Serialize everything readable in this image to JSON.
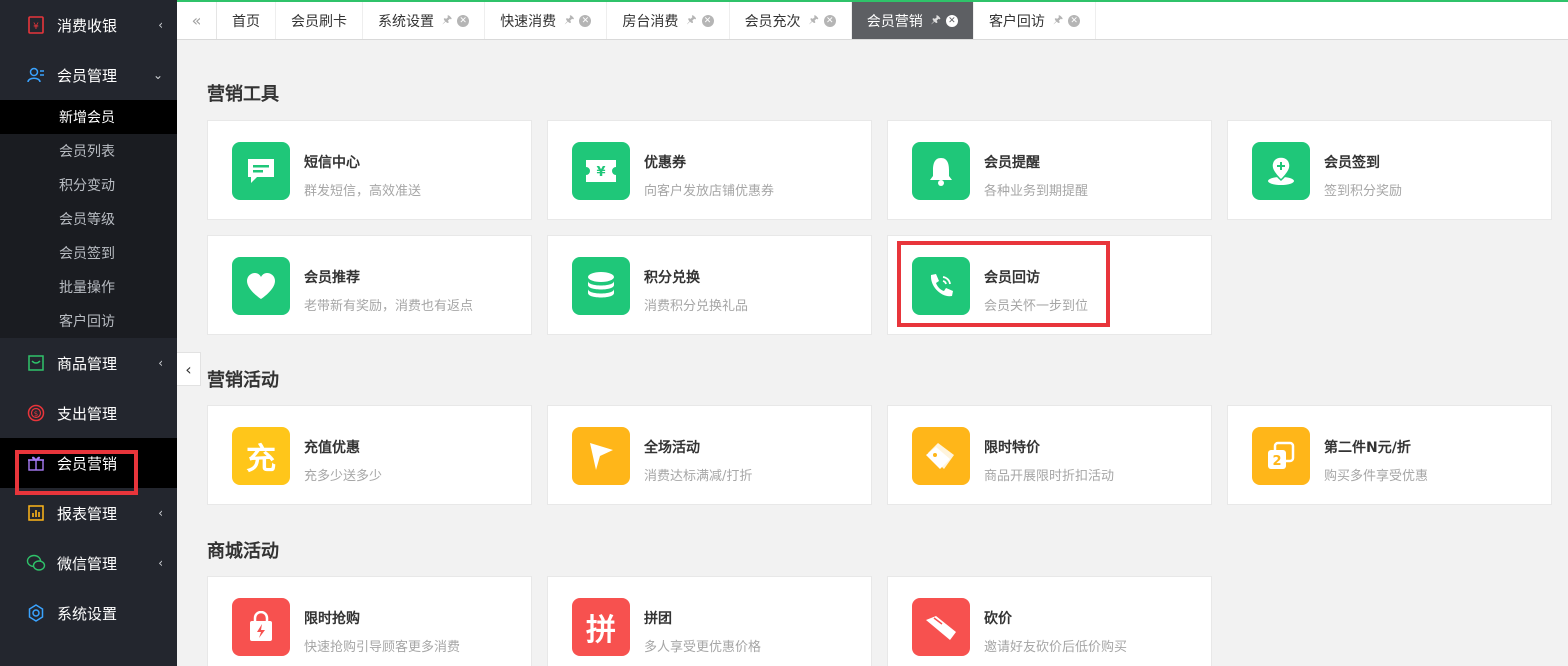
{
  "sidebar": {
    "items": [
      {
        "label": "消费收银",
        "icon": "cashier-icon",
        "arrow": "‹"
      },
      {
        "label": "会员管理",
        "icon": "member-icon",
        "arrow": "⌄"
      },
      {
        "label": "商品管理",
        "icon": "goods-icon",
        "arrow": "‹"
      },
      {
        "label": "支出管理",
        "icon": "expense-icon",
        "arrow": ""
      },
      {
        "label": "会员营销",
        "icon": "gift-icon",
        "arrow": ""
      },
      {
        "label": "报表管理",
        "icon": "report-icon",
        "arrow": "‹"
      },
      {
        "label": "微信管理",
        "icon": "wechat-icon",
        "arrow": "‹"
      },
      {
        "label": "系统设置",
        "icon": "settings-gear-icon",
        "arrow": ""
      }
    ],
    "submenu": [
      "新增会员",
      "会员列表",
      "积分变动",
      "会员等级",
      "会员签到",
      "批量操作",
      "客户回访"
    ]
  },
  "tabs": [
    {
      "label": "首页"
    },
    {
      "label": "会员刷卡"
    },
    {
      "label": "系统设置"
    },
    {
      "label": "快速消费"
    },
    {
      "label": "房台消费"
    },
    {
      "label": "会员充次"
    },
    {
      "label": "会员营销"
    },
    {
      "label": "客户回访"
    }
  ],
  "sections": {
    "tools": "营销工具",
    "activities": "营销活动",
    "mall": "商城活动"
  },
  "cards": {
    "sms": {
      "title": "短信中心",
      "desc": "群发短信，高效准送"
    },
    "coupon": {
      "title": "优惠券",
      "desc": "向客户发放店铺优惠券"
    },
    "remind": {
      "title": "会员提醒",
      "desc": "各种业务到期提醒"
    },
    "checkin": {
      "title": "会员签到",
      "desc": "签到积分奖励"
    },
    "recommend": {
      "title": "会员推荐",
      "desc": "老带新有奖励，消费也有返点"
    },
    "points": {
      "title": "积分兑换",
      "desc": "消费积分兑换礼品"
    },
    "revisit": {
      "title": "会员回访",
      "desc": "会员关怀一步到位"
    },
    "recharge": {
      "title": "充值优惠",
      "desc": "充多少送多少"
    },
    "storewide": {
      "title": "全场活动",
      "desc": "消费达标满减/打折"
    },
    "flash": {
      "title": "限时特价",
      "desc": "商品开展限时折扣活动"
    },
    "second": {
      "title": "第二件N元/折",
      "desc": "购买多件享受优惠"
    },
    "rush": {
      "title": "限时抢购",
      "desc": "快速抢购引导顾客更多消费"
    },
    "group": {
      "title": "拼团",
      "desc": "多人享受更优惠价格"
    },
    "bargain": {
      "title": "砍价",
      "desc": "邀请好友砍价后低价购买"
    }
  },
  "glyphs": {
    "recharge": "充",
    "group": "拼",
    "second_num": "2",
    "coupon": "¥"
  },
  "colors": {
    "green": "#1fc779",
    "yellow": "#ffb619",
    "red": "#f7514f",
    "highlight": "#e8353b",
    "accent": "#2fc36a"
  }
}
